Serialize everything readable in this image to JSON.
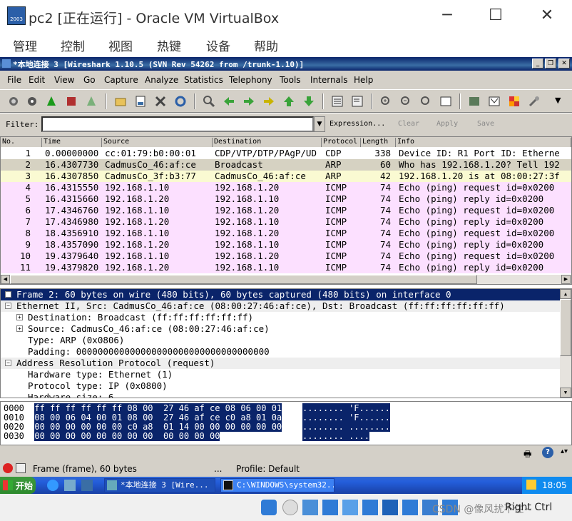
{
  "host": {
    "title": "pc2 [正在运行] - Oracle VM VirtualBox",
    "icon_text": "2003",
    "menu": [
      "管理",
      "控制",
      "视图",
      "热键",
      "设备",
      "帮助"
    ],
    "minimize": "─",
    "maximize": "☐",
    "close": "✕"
  },
  "guest_window": {
    "title": "*本地连接 3   [Wireshark 1.10.5  (SVN Rev 54262 from /trunk-1.10)]"
  },
  "menu": [
    "File",
    "Edit",
    "View",
    "Go",
    "Capture",
    "Analyze",
    "Statistics",
    "Telephony",
    "Tools",
    "Internals",
    "Help"
  ],
  "filter": {
    "label": "Filter:",
    "value": "",
    "buttons": [
      "Expression...",
      "Clear",
      "Apply",
      "Save"
    ]
  },
  "packet_list": {
    "columns": [
      "No.",
      "Time",
      "Source",
      "Destination",
      "Protocol",
      "Length",
      "Info"
    ],
    "rows": [
      {
        "no": "1",
        "time": "0.00000000",
        "src": "cc:01:79:b0:00:01",
        "dst": "CDP/VTP/DTP/PAgP/UD",
        "proto": "CDP",
        "len": "338",
        "info": "Device ID: R1  Port ID: Etherne",
        "bg": "#ffffff"
      },
      {
        "no": "2",
        "time": "16.4307730",
        "src": "CadmusCo_46:af:ce",
        "dst": "Broadcast",
        "proto": "ARP",
        "len": "60",
        "info": "Who has 192.168.1.20?  Tell 192",
        "bg": "#d6d2c2"
      },
      {
        "no": "3",
        "time": "16.4307850",
        "src": "CadmusCo_3f:b3:77",
        "dst": "CadmusCo_46:af:ce",
        "proto": "ARP",
        "len": "42",
        "info": "192.168.1.20 is at 08:00:27:3f",
        "bg": "#fafad2"
      },
      {
        "no": "4",
        "time": "16.4315550",
        "src": "192.168.1.10",
        "dst": "192.168.1.20",
        "proto": "ICMP",
        "len": "74",
        "info": "Echo (ping) request   id=0x0200",
        "bg": "#fce0ff"
      },
      {
        "no": "5",
        "time": "16.4315660",
        "src": "192.168.1.20",
        "dst": "192.168.1.10",
        "proto": "ICMP",
        "len": "74",
        "info": "Echo (ping) reply     id=0x0200",
        "bg": "#fce0ff"
      },
      {
        "no": "6",
        "time": "17.4346760",
        "src": "192.168.1.10",
        "dst": "192.168.1.20",
        "proto": "ICMP",
        "len": "74",
        "info": "Echo (ping) request   id=0x0200",
        "bg": "#fce0ff"
      },
      {
        "no": "7",
        "time": "17.4346980",
        "src": "192.168.1.20",
        "dst": "192.168.1.10",
        "proto": "ICMP",
        "len": "74",
        "info": "Echo (ping) reply     id=0x0200",
        "bg": "#fce0ff"
      },
      {
        "no": "8",
        "time": "18.4356910",
        "src": "192.168.1.10",
        "dst": "192.168.1.20",
        "proto": "ICMP",
        "len": "74",
        "info": "Echo (ping) request   id=0x0200",
        "bg": "#fce0ff"
      },
      {
        "no": "9",
        "time": "18.4357090",
        "src": "192.168.1.20",
        "dst": "192.168.1.10",
        "proto": "ICMP",
        "len": "74",
        "info": "Echo (ping) reply     id=0x0200",
        "bg": "#fce0ff"
      },
      {
        "no": "10",
        "time": "19.4379640",
        "src": "192.168.1.10",
        "dst": "192.168.1.20",
        "proto": "ICMP",
        "len": "74",
        "info": "Echo (ping) request   id=0x0200",
        "bg": "#fce0ff"
      },
      {
        "no": "11",
        "time": "19.4379820",
        "src": "192.168.1.20",
        "dst": "192.168.1.10",
        "proto": "ICMP",
        "len": "74",
        "info": "Echo (ping) reply     id=0x0200",
        "bg": "#fce0ff"
      }
    ]
  },
  "detail": {
    "lines": [
      {
        "text": "Frame 2: 60 bytes on wire (480 bits), 60 bytes captured (480 bits) on interface 0",
        "indent": 0,
        "exp": "+",
        "sel": true
      },
      {
        "text": "Ethernet II, Src: CadmusCo_46:af:ce (08:00:27:46:af:ce), Dst: Broadcast (ff:ff:ff:ff:ff:ff)",
        "indent": 0,
        "exp": "−",
        "sel": false
      },
      {
        "text": "Destination: Broadcast (ff:ff:ff:ff:ff:ff)",
        "indent": 1,
        "exp": "+",
        "sel": false
      },
      {
        "text": "Source: CadmusCo_46:af:ce (08:00:27:46:af:ce)",
        "indent": 1,
        "exp": "+",
        "sel": false
      },
      {
        "text": "Type: ARP (0x0806)",
        "indent": 1,
        "exp": "",
        "sel": false
      },
      {
        "text": "Padding: 000000000000000000000000000000000000",
        "indent": 1,
        "exp": "",
        "sel": false
      },
      {
        "text": "Address Resolution Protocol (request)",
        "indent": 0,
        "exp": "−",
        "sel": false
      },
      {
        "text": "Hardware type: Ethernet (1)",
        "indent": 1,
        "exp": "",
        "sel": false
      },
      {
        "text": "Protocol type: IP (0x0800)",
        "indent": 1,
        "exp": "",
        "sel": false
      },
      {
        "text": "Hardware size: 6",
        "indent": 1,
        "exp": "",
        "sel": false
      }
    ]
  },
  "hex": {
    "rows": [
      {
        "off": "0000",
        "bytes": "ff ff ff ff ff ff 08 00  27 46 af ce 08 06 00 01",
        "ascii": "........ 'F......"
      },
      {
        "off": "0010",
        "bytes": "08 00 06 04 00 01 08 00  27 46 af ce c0 a8 01 0a",
        "ascii": "........ 'F......"
      },
      {
        "off": "0020",
        "bytes": "00 00 00 00 00 00 c0 a8  01 14 00 00 00 00 00 00",
        "ascii": "........ ........"
      },
      {
        "off": "0030",
        "bytes": "00 00 00 00 00 00 00 00  00 00 00 00",
        "ascii": "........ ...."
      }
    ]
  },
  "status": {
    "frame": "Frame (frame), 60 bytes",
    "dots": "...",
    "profile": "Profile: Default"
  },
  "taskbar": {
    "start": "开始",
    "tasks": [
      "*本地连接 3   [Wire...",
      "C:\\WINDOWS\\system32..."
    ],
    "clock": "18:05"
  },
  "host_status": {
    "watermark": "CSDN @像风扰不住~",
    "hotkey": "Right Ctrl"
  },
  "colors": {
    "selected": "#0a246a",
    "icmp_row": "#fce0ff",
    "arp_row": "#fafad2"
  }
}
